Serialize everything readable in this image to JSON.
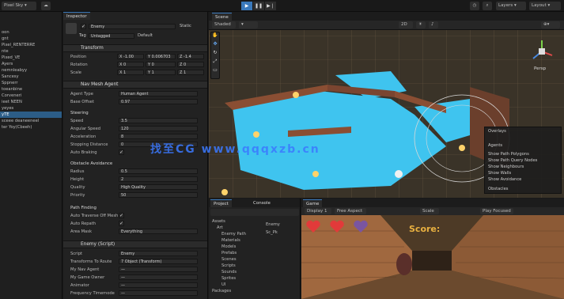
{
  "toolbar": {
    "account": "Pixel Sky ▾",
    "layers": "Layers ▾",
    "layout": "Layout ▾",
    "colors": {
      "play_active": "#3a79bb"
    }
  },
  "hierarchy": {
    "rows": [
      "oon",
      "gnt",
      "Pixel_RENTERRE",
      "nte",
      "Pixed_VE",
      "Ayers",
      "nemnleabyy",
      "Sancesy",
      "Sppnerr",
      "toeanbine",
      "Corveneri",
      "ieet NEEN",
      "yeyes",
      "yTE",
      "sceee deaneeneel",
      "ter Yoy(Cbeeh)"
    ]
  },
  "inspector": {
    "tab": "Inspector",
    "object_name": "Enemy",
    "tag_label": "Tag",
    "tag_value": "Untagged",
    "layer_label": "Layer",
    "layer_value": "Default",
    "static_label": "Static",
    "transform": {
      "title": "Transform",
      "rows": [
        {
          "label": "Position",
          "x": "X -1.00",
          "y": "Y 0.006703",
          "z": "Z -1.4"
        },
        {
          "label": "Rotation",
          "x": "X 0",
          "y": "Y 0",
          "z": "Z 0"
        },
        {
          "label": "Scale",
          "x": "X 1",
          "y": "Y 1",
          "z": "Z 1"
        }
      ]
    },
    "nav_mesh_agent": {
      "title": "Nav Mesh Agent",
      "agent_type_label": "Agent Type",
      "agent_type_value": "Human Agent",
      "base_offset_label": "Base Offset",
      "base_offset_value": "0.97",
      "steering_title": "Steering",
      "speed_label": "Speed",
      "speed_value": "3.5",
      "angular_label": "Angular Speed",
      "angular_value": "120",
      "accel_label": "Acceleration",
      "accel_value": "8",
      "stopping_label": "Stopping Distance",
      "stopping_value": "0",
      "auto_braking_label": "Auto Braking",
      "avoidance_title": "Obstacle Avoidance",
      "radius_label": "Radius",
      "radius_value": "0.5",
      "height_label": "Height",
      "height_value": "2",
      "quality_label": "Quality",
      "quality_value": "High Quality",
      "priority_label": "Priority",
      "priority_value": "50",
      "pathfinding_title": "Path Finding",
      "auto_traverse_label": "Auto Traverse Off Mesh",
      "auto_repath_label": "Auto Repath",
      "area_mask_label": "Area Mask",
      "area_mask_value": "Everything"
    },
    "script": {
      "title": "Enemy (Script)",
      "rows": [
        {
          "label": "Script",
          "value": "Enemy"
        },
        {
          "label": "Transforms To Route",
          "value": "7 Object (Transform)"
        },
        {
          "label": "My Nav Agent",
          "value": "—"
        },
        {
          "label": "My Game Owner",
          "value": "—"
        },
        {
          "label": "Animator",
          "value": "—"
        },
        {
          "label": "Frequency Timemode",
          "value": "—"
        }
      ]
    }
  },
  "scene": {
    "tab": "Scene",
    "draw_mode": "Shaded",
    "persp_label": "Persp",
    "colors": {
      "water": "#3fc4ef",
      "floor": "#3a3328"
    },
    "overlay": {
      "items": [
        "Overlays",
        "Agents",
        "Show Path Polygons",
        "Show Path Query Nodes",
        "Show Neighbours",
        "Show Walls",
        "Show Avoidance",
        "Obstacles"
      ]
    }
  },
  "project": {
    "tab": "Project",
    "console_tab": "Console",
    "folders": [
      "Assets",
      "Art",
      "Enemy Path",
      "Materials",
      "Models",
      "Prefabs",
      "Scenes",
      "Scripts",
      "Sounds",
      "Sprites",
      "UI",
      "Packages"
    ],
    "files": [
      "Enemy",
      "Sc_Pk"
    ]
  },
  "game": {
    "tab": "Game",
    "display": "Display 1",
    "aspect": "Free Aspect",
    "scale_label": "Scale",
    "play_focused": "Play Focused",
    "score": "Score:",
    "hearts": [
      "#e23a3a",
      "#e23a3a",
      "#7a55a0"
    ]
  },
  "watermark": {
    "text": "找至CG www.qqqxzb.cn"
  }
}
